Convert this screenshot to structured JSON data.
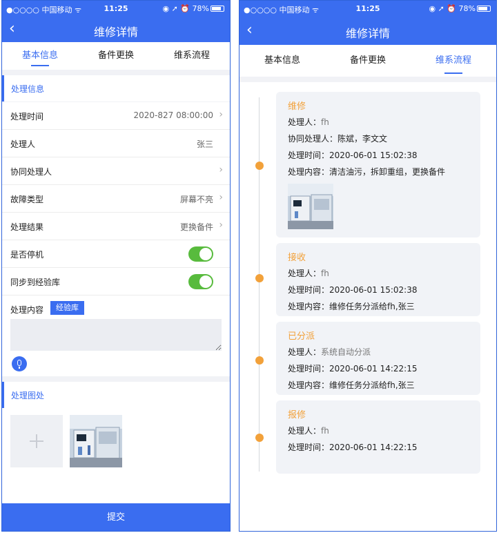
{
  "left": {
    "status_bar": {
      "carrier": "●○○○○ 中国移动 ᯤ",
      "time": "11:25",
      "right": "◉ ➚ ⏰ 78%"
    },
    "nav": {
      "back_icon": "chevron-left-icon",
      "title": "维修详情"
    },
    "tabs": [
      {
        "label": "基本信息",
        "active": true
      },
      {
        "label": "备件更换",
        "active": false
      },
      {
        "label": "维系流程",
        "active": false
      }
    ],
    "process_info": {
      "heading": "处理信息",
      "rows": [
        {
          "label": "处理时间",
          "value": "2020-827 08:00:00"
        },
        {
          "label": "处理人",
          "value": "张三"
        },
        {
          "label": "协同处理人",
          "value": ""
        },
        {
          "label": "故障类型",
          "value": "屏幕不亮"
        },
        {
          "label": "处理结果",
          "value": "更换备件"
        }
      ],
      "toggles": [
        {
          "label": "是否停机",
          "on": true
        },
        {
          "label": "同步到经验库",
          "on": true
        }
      ],
      "content_label": "处理内容",
      "experience_button": "经验库"
    },
    "photos": {
      "heading": "处理图处"
    },
    "submit": "提交"
  },
  "right": {
    "status_bar": {
      "carrier": "●○○○○ 中国移动 ᯤ",
      "time": "11:25",
      "right": "◉ ➚ ⏰ 78%"
    },
    "nav": {
      "back_icon": "chevron-left-icon",
      "title": "维修详情"
    },
    "tabs": [
      {
        "label": "基本信息",
        "active": false
      },
      {
        "label": "备件更换",
        "active": false
      },
      {
        "label": "维系流程",
        "active": true
      }
    ],
    "timeline": [
      {
        "status": "维修",
        "lines": [
          {
            "k": "处理人：",
            "v": "fh"
          },
          {
            "k": "协同处理人：",
            "v": "陈斌，李文文"
          },
          {
            "k": "处理时间：",
            "v": "2020-06-01 15:02:38"
          },
          {
            "k": "处理内容：",
            "v": "清洁油污，拆卸重组，更换备件"
          }
        ]
      },
      {
        "status": "接收",
        "lines": [
          {
            "k": "处理人：",
            "v": "fh"
          },
          {
            "k": "处理时间：",
            "v": "2020-06-01 15:02:38"
          },
          {
            "k": "处理内容：",
            "v": "维修任务分派给fh,张三"
          }
        ]
      },
      {
        "status": "已分派",
        "lines": [
          {
            "k": "处理人：",
            "v": "系统自动分派"
          },
          {
            "k": "处理时间：",
            "v": "2020-06-01 14:22:15"
          },
          {
            "k": "处理内容：",
            "v": "维修任务分派给fh,张三"
          }
        ]
      },
      {
        "status": "报修",
        "lines": [
          {
            "k": "处理人：",
            "v": "fh"
          },
          {
            "k": "处理时间：",
            "v": "2020-06-01 14:22:15"
          }
        ]
      }
    ]
  },
  "colors": {
    "primary": "#3a6df0",
    "accent_orange": "#f2a13a",
    "toggle_green": "#58bb3d"
  }
}
